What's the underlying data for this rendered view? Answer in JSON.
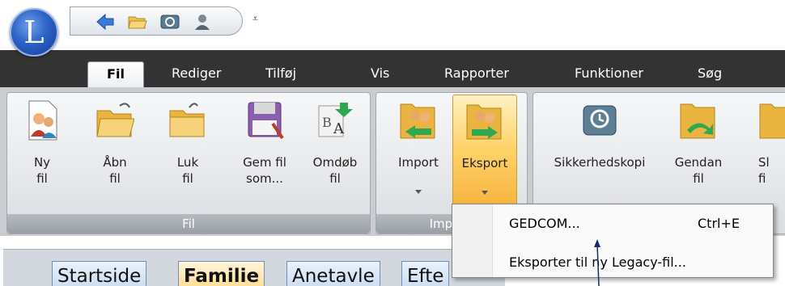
{
  "app": {
    "logo_letter": "L"
  },
  "quick_access": {
    "icons": [
      "back-arrow-icon",
      "open-folder-icon",
      "backup-icon",
      "person-icon"
    ],
    "more_label": "⩡"
  },
  "menu": {
    "tabs": [
      "Fil",
      "Rediger",
      "Tilføj",
      "Vis",
      "Rapporter",
      "Funktioner",
      "Søg"
    ],
    "active": "Fil"
  },
  "ribbon": {
    "groups": [
      {
        "label": "Fil",
        "buttons": [
          {
            "line1": "Ny",
            "line2": "fil"
          },
          {
            "line1": "Åbn",
            "line2": "fil"
          },
          {
            "line1": "Luk",
            "line2": "fil"
          },
          {
            "line1": "Gem fil",
            "line2": "som..."
          },
          {
            "line1": "Omdøb",
            "line2": "fil"
          }
        ]
      },
      {
        "label": "Import/",
        "buttons": [
          {
            "line1": "Import",
            "line2": ""
          },
          {
            "line1": "Eksport",
            "line2": ""
          }
        ]
      },
      {
        "label": "",
        "buttons": [
          {
            "line1": "Sikkerhedskopi",
            "line2": ""
          },
          {
            "line1": "Gendan",
            "line2": "fil"
          },
          {
            "line1": "Sl",
            "line2": "fi"
          }
        ]
      }
    ]
  },
  "doc_tabs": [
    "Startside",
    "Familie",
    "Anetavle",
    "Efte"
  ],
  "doc_tab_active": "Familie",
  "export_menu": {
    "items": [
      {
        "label": "GEDCOM...",
        "shortcut": "Ctrl+E"
      },
      {
        "label": "Eksporter til ny Legacy-fil...",
        "shortcut": ""
      }
    ]
  },
  "colors": {
    "menubar": "#333333",
    "hot_button": "#ffd36a",
    "ribbon_bg": "#c9cdd2"
  }
}
